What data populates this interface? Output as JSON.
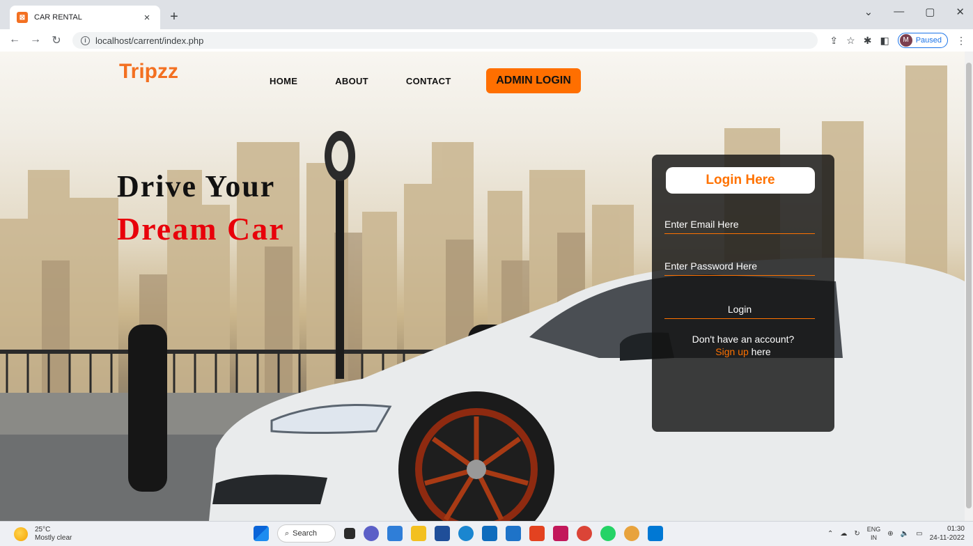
{
  "browser": {
    "tab_title": "CAR RENTAL",
    "tab_close": "×",
    "new_tab": "+",
    "url": "localhost/carrent/index.php",
    "profile_initial": "M",
    "profile_status": "Paused"
  },
  "site": {
    "logo": "Tripzz",
    "nav": [
      {
        "label": "HOME"
      },
      {
        "label": "ABOUT"
      },
      {
        "label": "CONTACT"
      }
    ],
    "admin_button": "ADMIN LOGIN",
    "hero_line1": "Drive Your",
    "hero_line2": "Dream Car",
    "login": {
      "title": "Login Here",
      "email_placeholder": "Enter Email Here",
      "password_placeholder": "Enter Password Here",
      "button": "Login",
      "no_account": "Don't have an account?",
      "signup_link": "Sign up",
      "signup_suffix": " here"
    }
  },
  "taskbar": {
    "temperature": "25°C",
    "weather": "Mostly clear",
    "search": "Search",
    "lang_top": "ENG",
    "lang_bottom": "IN",
    "time": "01:30",
    "date": "24-11-2022"
  },
  "colors": {
    "accent": "#ff7200",
    "hero_red": "#e8000a",
    "admin_btn": "#ff6f00"
  }
}
